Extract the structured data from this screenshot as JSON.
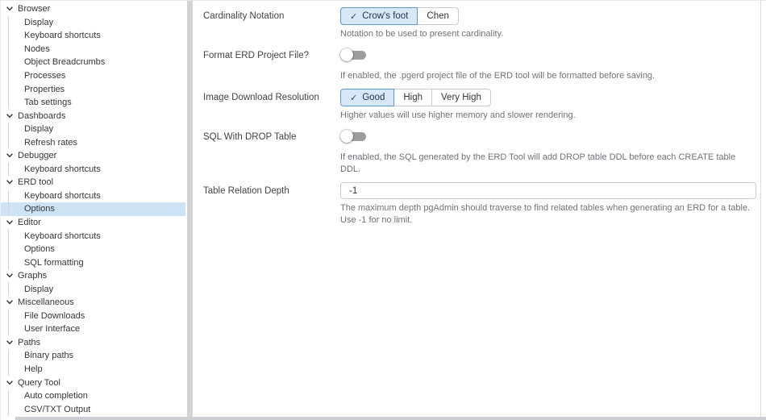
{
  "icons": {
    "check": "✓",
    "chevron": "chevron-down"
  },
  "colors": {
    "tree_selected_bg": "#cee4f6",
    "selected_button_bg": "#d7e8f8",
    "selected_button_border": "#5e97d2",
    "toggle_track_off": "#9b9da1",
    "splitter": "#d3d4d6",
    "helper_text": "#6e737b"
  },
  "sidebar": {
    "items": [
      {
        "label": "Browser",
        "level": 0,
        "expanded": true
      },
      {
        "label": "Display",
        "level": 1
      },
      {
        "label": "Keyboard shortcuts",
        "level": 1
      },
      {
        "label": "Nodes",
        "level": 1
      },
      {
        "label": "Object Breadcrumbs",
        "level": 1
      },
      {
        "label": "Processes",
        "level": 1
      },
      {
        "label": "Properties",
        "level": 1
      },
      {
        "label": "Tab settings",
        "level": 1
      },
      {
        "label": "Dashboards",
        "level": 0,
        "expanded": true
      },
      {
        "label": "Display",
        "level": 1
      },
      {
        "label": "Refresh rates",
        "level": 1
      },
      {
        "label": "Debugger",
        "level": 0,
        "expanded": true
      },
      {
        "label": "Keyboard shortcuts",
        "level": 1
      },
      {
        "label": "ERD tool",
        "level": 0,
        "expanded": true
      },
      {
        "label": "Keyboard shortcuts",
        "level": 1
      },
      {
        "label": "Options",
        "level": 1,
        "selected": true
      },
      {
        "label": "Editor",
        "level": 0,
        "expanded": true
      },
      {
        "label": "Keyboard shortcuts",
        "level": 1
      },
      {
        "label": "Options",
        "level": 1
      },
      {
        "label": "SQL formatting",
        "level": 1
      },
      {
        "label": "Graphs",
        "level": 0,
        "expanded": true
      },
      {
        "label": "Display",
        "level": 1
      },
      {
        "label": "Miscellaneous",
        "level": 0,
        "expanded": true
      },
      {
        "label": "File Downloads",
        "level": 1
      },
      {
        "label": "User Interface",
        "level": 1
      },
      {
        "label": "Paths",
        "level": 0,
        "expanded": true
      },
      {
        "label": "Binary paths",
        "level": 1
      },
      {
        "label": "Help",
        "level": 1
      },
      {
        "label": "Query Tool",
        "level": 0,
        "expanded": true
      },
      {
        "label": "Auto completion",
        "level": 1
      },
      {
        "label": "CSV/TXT Output",
        "level": 1
      }
    ]
  },
  "panel": {
    "cardinality": {
      "label": "Cardinality Notation",
      "options": [
        "Crow's foot",
        "Chen"
      ],
      "selected": "Crow's foot",
      "help": "Notation to be used to present cardinality."
    },
    "format_erd": {
      "label": "Format ERD Project File?",
      "enabled": false,
      "help": "If enabled, the .pgerd project file of the ERD tool will be formatted before saving."
    },
    "image_resolution": {
      "label": "Image Download Resolution",
      "options": [
        "Good",
        "High",
        "Very High"
      ],
      "selected": "Good",
      "help": "Higher values will use higher memory and slower rendering."
    },
    "sql_drop": {
      "label": "SQL With DROP Table",
      "enabled": false,
      "help": "If enabled, the SQL generated by the ERD Tool will add DROP table DDL before each CREATE table DDL."
    },
    "depth": {
      "label": "Table Relation Depth",
      "value": "-1",
      "help": "The maximum depth pgAdmin should traverse to find related tables when generating an ERD for a table. Use -1 for no limit."
    }
  }
}
